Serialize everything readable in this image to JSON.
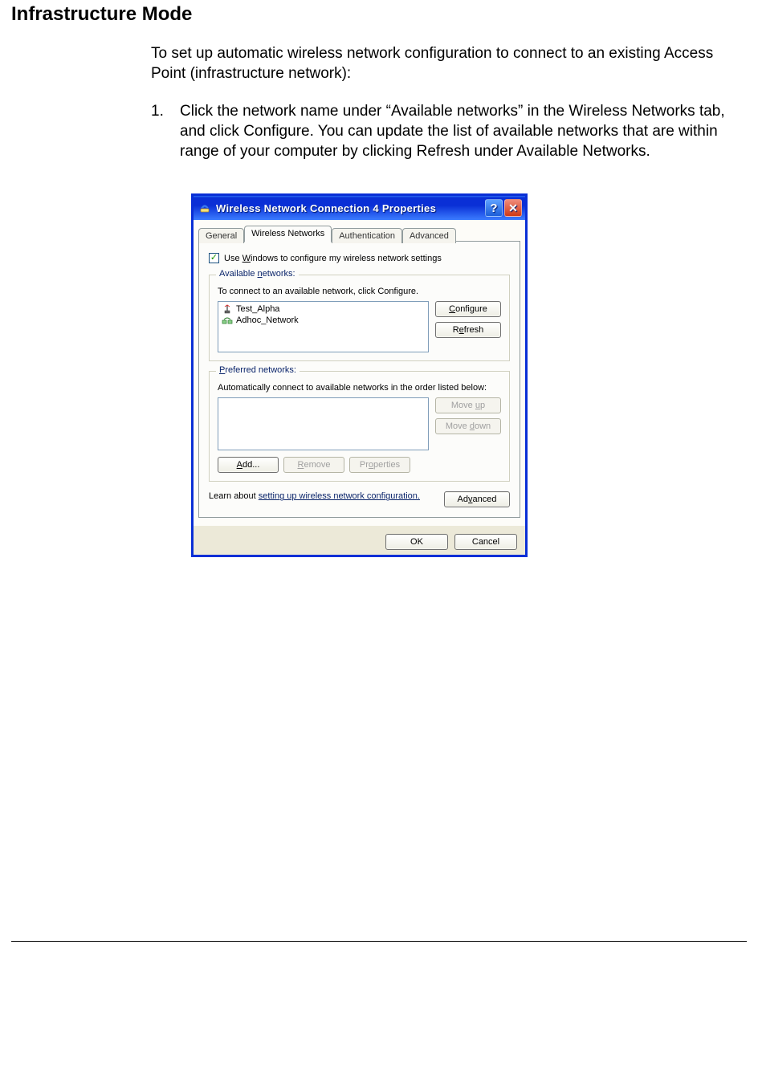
{
  "doc": {
    "heading": "Infrastructure Mode",
    "intro": "To set up automatic wireless network configuration to connect to an existing Access Point (infrastructure network):",
    "step_num": "1.",
    "step_text": "Click the network name under “Available networks” in the Wireless Networks tab, and click Configure. You can update the list of available networks that are within range of your computer by clicking Refresh under Available Networks."
  },
  "dialog": {
    "title": "Wireless Network Connection 4 Properties",
    "help_glyph": "?",
    "close_glyph": "✕",
    "tabs": [
      {
        "label": "General",
        "active": false
      },
      {
        "label": "Wireless Networks",
        "active": true
      },
      {
        "label": "Authentication",
        "active": false
      },
      {
        "label": "Advanced",
        "active": false
      }
    ],
    "use_windows_check_glyph": "✓",
    "use_windows_pre": "Use ",
    "use_windows_u": "W",
    "use_windows_post": "indows to configure my wireless network settings",
    "available": {
      "legend_pre": "Available ",
      "legend_u": "n",
      "legend_post": "etworks:",
      "desc": "To connect to an available network, click Configure.",
      "items": [
        {
          "name": "Test_Alpha",
          "icon": "infra"
        },
        {
          "name": "Adhoc_Network",
          "icon": "adhoc"
        }
      ],
      "configure_u": "C",
      "configure_post": "onfigure",
      "refresh_pre": "R",
      "refresh_u": "e",
      "refresh_post": "fresh"
    },
    "preferred": {
      "legend_u": "P",
      "legend_post": "referred networks:",
      "desc": "Automatically connect to available networks in the order listed below:",
      "moveup_pre": "Move ",
      "moveup_u": "u",
      "moveup_post": "p",
      "movedown_pre": "Move ",
      "movedown_u": "d",
      "movedown_post": "own",
      "add_u": "A",
      "add_post": "dd...",
      "remove_u": "R",
      "remove_post": "emove",
      "properties_pre": "Pr",
      "properties_u": "o",
      "properties_post": "perties"
    },
    "learn_pre": "Learn about ",
    "learn_link": "setting up wireless network configuration.",
    "advanced_pre": "Ad",
    "advanced_u": "v",
    "advanced_post": "anced",
    "ok": "OK",
    "cancel": "Cancel"
  }
}
